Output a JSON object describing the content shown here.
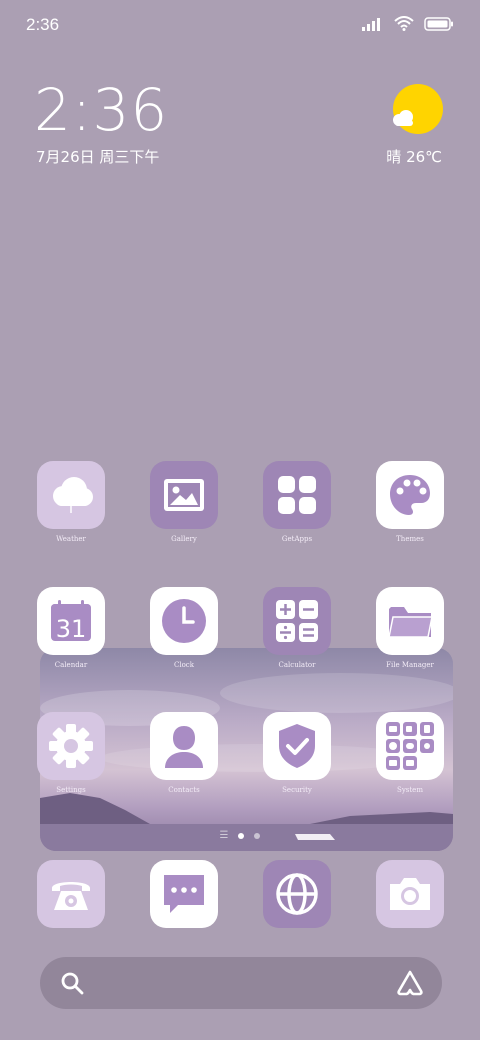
{
  "status_bar": {
    "time": "2:36"
  },
  "clock_widget": {
    "time": "2:36",
    "date": "7月26日 周三下午"
  },
  "weather_widget": {
    "condition_temp": "晴 26℃"
  },
  "apps": {
    "weather": "Weather",
    "gallery": "Gallery",
    "getapps": "GetApps",
    "themes": "Themes",
    "calendar": "Calendar",
    "calendar_day": "31",
    "clock": "Clock",
    "calculator": "Calculator",
    "file_manager": "File Manager",
    "settings": "Settings",
    "contacts": "Contacts",
    "security": "Security",
    "system": "System"
  },
  "dock": [
    "phone-icon",
    "messages-icon",
    "browser-icon",
    "camera-icon"
  ],
  "page_indicator": {
    "pages": 2,
    "active": 0
  },
  "colors": {
    "background": "#ab9fb3",
    "accent": "#9e86b5",
    "sun": "#ffd400"
  }
}
